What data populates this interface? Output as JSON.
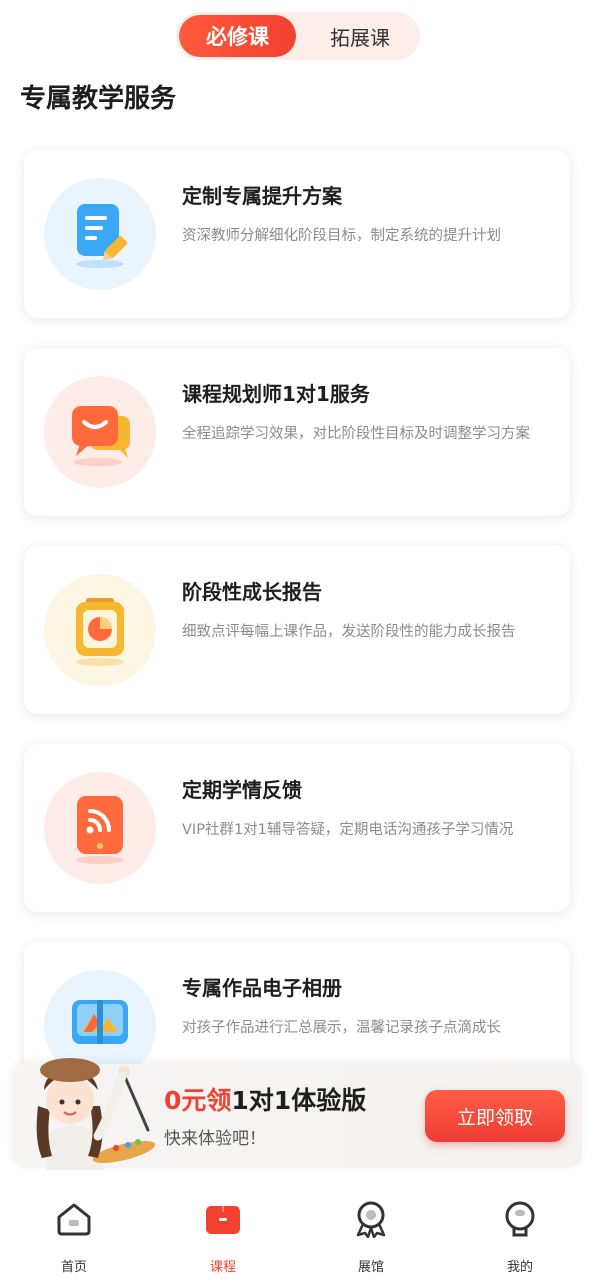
{
  "tabs": [
    {
      "label": "必修课",
      "active": true
    },
    {
      "label": "拓展课",
      "active": false
    }
  ],
  "section_title": "专属教学服务",
  "cards": [
    {
      "title": "定制专属提升方案",
      "desc": "资深教师分解细化阶段目标，制定系统的提升计划",
      "icon": "document-pen-icon",
      "bg": "#e9f4fd"
    },
    {
      "title": "课程规划师1对1服务",
      "desc": "全程追踪学习效果，对比阶段性目标及时调整学习方案",
      "icon": "chat-bubbles-icon",
      "bg": "#fdece8"
    },
    {
      "title": "阶段性成长报告",
      "desc": "细致点评每幅上课作品，发送阶段性的能力成长报告",
      "icon": "clipboard-chart-icon",
      "bg": "#fdf6e3"
    },
    {
      "title": "定期学情反馈",
      "desc": "VIP社群1对1辅导答疑，定期电话沟通孩子学习情况",
      "icon": "phone-signal-icon",
      "bg": "#fdece8"
    },
    {
      "title": "专属作品电子相册",
      "desc": "对孩子作品进行汇总展示，温馨记录孩子点滴成长",
      "icon": "photo-album-icon",
      "bg": "#e9f4fd"
    }
  ],
  "promo": {
    "title_red": "0元领",
    "title_rest": "1对1体验版",
    "subtitle": "快来体验吧！",
    "button": "立即领取"
  },
  "nav": [
    {
      "label": "首页",
      "icon": "home-icon",
      "active": false
    },
    {
      "label": "课程",
      "icon": "course-book-icon",
      "active": true
    },
    {
      "label": "展馆",
      "icon": "medal-icon",
      "active": false
    },
    {
      "label": "我的",
      "icon": "profile-icon",
      "active": false
    }
  ],
  "colors": {
    "accent": "#f2412f",
    "blue_icon": "#3aa8f5",
    "orange_icon": "#ff6a3d",
    "yellow_icon": "#f7b731"
  }
}
